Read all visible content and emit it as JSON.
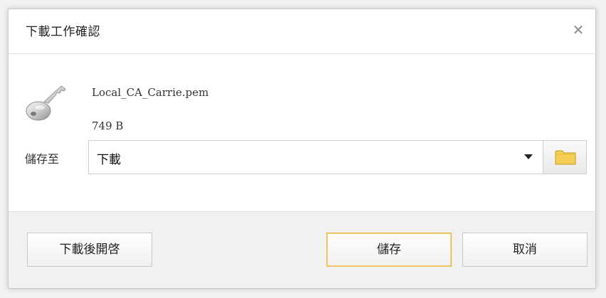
{
  "dialog": {
    "title": "下載工作確認",
    "close_icon": "close-icon"
  },
  "file": {
    "icon": "key-icon",
    "name": "Local_CA_Carrie.pem",
    "size": "749 B"
  },
  "save_to": {
    "label": "儲存至",
    "selected_location": "下載",
    "dropdown_icon": "chevron-down-icon",
    "folder_icon": "folder-icon"
  },
  "footer": {
    "open_after_download_label": "下載後開啓",
    "save_label": "儲存",
    "cancel_label": "取消"
  },
  "colors": {
    "folder": "#f5cf55",
    "save_button_border": "#f0b340"
  }
}
